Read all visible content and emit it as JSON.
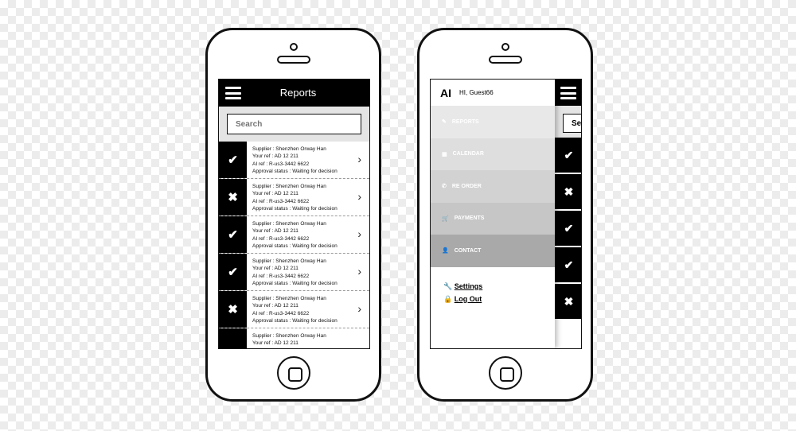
{
  "left_phone": {
    "header": {
      "title": "Reports",
      "menu_icon": "hamburger-icon"
    },
    "search": {
      "placeholder": "Search"
    },
    "rows": [
      {
        "status": "approved",
        "icon": "✔",
        "supplier": "Supplier : Shenzhen Orway Han",
        "your_ref": "Your ref : AD 12 211",
        "ai_ref": "AI ref : R-us3-3442 6622",
        "approval": "Approval status : Waiting for decision"
      },
      {
        "status": "rejected",
        "icon": "✖",
        "supplier": "Supplier : Shenzhen Orway Han",
        "your_ref": "Your ref : AD 12 211",
        "ai_ref": "AI ref : R-us3-3442 6622",
        "approval": "Approval status : Waiting for decision"
      },
      {
        "status": "approved",
        "icon": "✔",
        "supplier": "Supplier : Shenzhen Orway Han",
        "your_ref": "Your ref : AD 12 211",
        "ai_ref": "AI ref : R-us3-3442 6622",
        "approval": "Approval status : Waiting for decision"
      },
      {
        "status": "approved",
        "icon": "✔",
        "supplier": "Supplier : Shenzhen Orway Han",
        "your_ref": "Your ref : AD 12 211",
        "ai_ref": "AI ref : R-us3-3442 6622",
        "approval": "Approval status : Waiting for decision"
      },
      {
        "status": "rejected",
        "icon": "✖",
        "supplier": "Supplier : Shenzhen Orway Han",
        "your_ref": "Your ref : AD 12 211",
        "ai_ref": "AI ref : R-us3-3442 6622",
        "approval": "Approval status : Waiting for decision"
      },
      {
        "status": "",
        "icon": "",
        "supplier": "Supplier : Shenzhen Orway Han",
        "your_ref": "Your ref : AD 12 211",
        "ai_ref": "",
        "approval": ""
      }
    ]
  },
  "right_phone": {
    "drawer": {
      "logo": "AI",
      "greeting": "HI, Guest66",
      "menu": [
        {
          "label": "REPORTS",
          "icon": "✎",
          "bg": "#e8e8e8"
        },
        {
          "label": "CALENDAR",
          "icon": "▦",
          "bg": "#dedede"
        },
        {
          "label": "RE ORDER",
          "icon": "✆",
          "bg": "#d2d2d2"
        },
        {
          "label": "PAYMENTS",
          "icon": "🛒",
          "bg": "#c6c6c6"
        },
        {
          "label": "CONTACT",
          "icon": "👤",
          "bg": "#a9a9a9"
        }
      ],
      "settings": "Settings",
      "logout": "Log Out"
    },
    "search_peek": "Se",
    "strip_icons": [
      "✔",
      "✖",
      "✔",
      "✔",
      "✖"
    ]
  }
}
